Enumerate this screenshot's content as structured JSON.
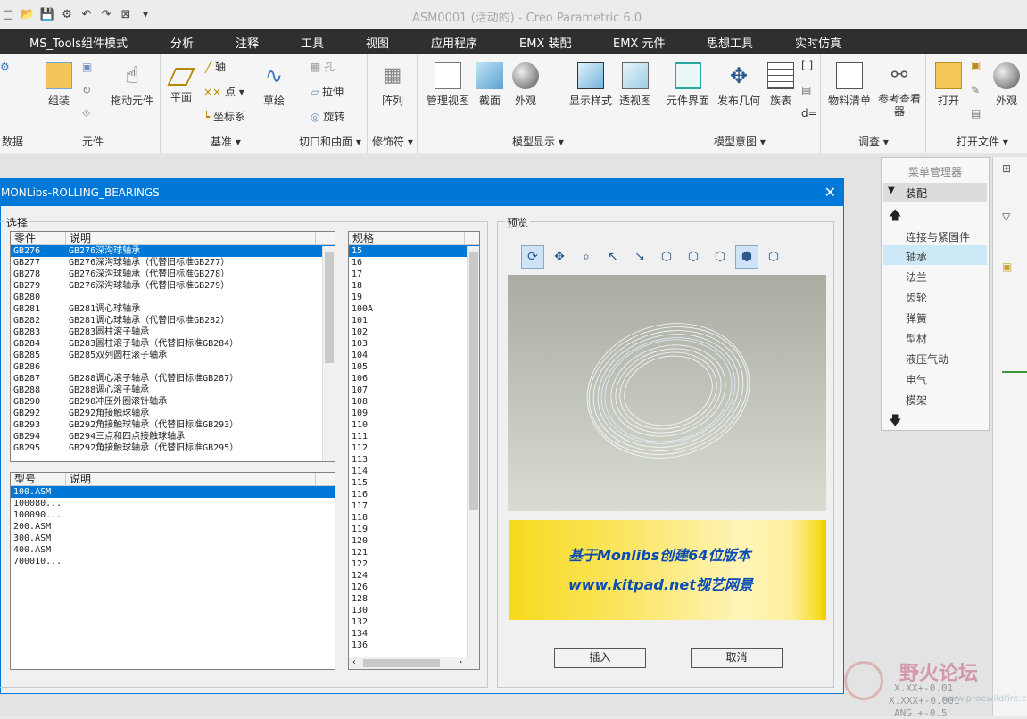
{
  "window": {
    "title": "ASM0001 (活动的) - Creo Parametric 6.0"
  },
  "menubar": [
    "MS_Tools组件模式",
    "分析",
    "注释",
    "工具",
    "视图",
    "应用程序",
    "EMX 装配",
    "EMX 元件",
    "思想工具",
    "实时仿真"
  ],
  "ribbon": {
    "groups": {
      "data": "数据",
      "component": "元件",
      "datum": "基准",
      "cut_surface": "切口和曲面",
      "modifier": "修饰符",
      "model_display": "模型显示",
      "model_intent": "模型意图",
      "investigate": "调查",
      "open_file": "打开文件"
    },
    "buttons": {
      "assemble": "组装",
      "drag": "拖动元件",
      "plane": "平面",
      "axis": "轴",
      "point": "点",
      "csys": "坐标系",
      "sketch": "草绘",
      "hole": "孔",
      "extrude": "拉伸",
      "revolve": "旋转",
      "pattern": "阵列",
      "manage_views": "管理视图",
      "section": "截面",
      "appearance": "外观",
      "display_style": "显示样式",
      "perspective": "透视图",
      "component_interface": "元件界面",
      "publish_geometry": "发布几何",
      "family_table": "族表",
      "bom": "物料清单",
      "ref_viewer": "参考查看器",
      "open": "打开",
      "appearance2": "外观"
    }
  },
  "dialog": {
    "title": "MONLibs-ROLLING_BEARINGS",
    "select_label": "选择",
    "preview_label": "预览",
    "parts_header": [
      "零件",
      "说明"
    ],
    "parts": [
      [
        "GB276",
        "GB276深沟球轴承"
      ],
      [
        "GB277",
        "GB276深沟球轴承（代替旧标准GB277）"
      ],
      [
        "GB278",
        "GB276深沟球轴承（代替旧标准GB278）"
      ],
      [
        "GB279",
        "GB276深沟球轴承（代替旧标准GB279）"
      ],
      [
        "GB280",
        ""
      ],
      [
        "GB281",
        "GB281调心球轴承"
      ],
      [
        "GB282",
        "GB281调心球轴承（代替旧标准GB282）"
      ],
      [
        "GB283",
        "GB283圆柱滚子轴承"
      ],
      [
        "GB284",
        "GB283圆柱滚子轴承（代替旧标准GB284）"
      ],
      [
        "GB285",
        "GB285双列圆柱滚子轴承"
      ],
      [
        "GB286",
        ""
      ],
      [
        "GB287",
        "GB288调心滚子轴承（代替旧标准GB287）"
      ],
      [
        "GB288",
        "GB288调心滚子轴承"
      ],
      [
        "GB290",
        "GB290冲压外圈滚针轴承"
      ],
      [
        "GB292",
        "GB292角接触球轴承"
      ],
      [
        "GB293",
        "GB292角接触球轴承（代替旧标准GB293）"
      ],
      [
        "GB294",
        "GB294三点和四点接触球轴承"
      ],
      [
        "GB295",
        "GB292角接触球轴承（代替旧标准GB295）"
      ]
    ],
    "types_header": [
      "型号",
      "说明"
    ],
    "types": [
      "100.ASM",
      "100080...",
      "100090...",
      "200.ASM",
      "300.ASM",
      "400.ASM",
      "700010..."
    ],
    "specs_header": "规格",
    "specs": [
      "15",
      "16",
      "17",
      "18",
      "19",
      "100A",
      "101",
      "102",
      "103",
      "104",
      "105",
      "106",
      "107",
      "108",
      "109",
      "110",
      "111",
      "112",
      "113",
      "114",
      "115",
      "116",
      "117",
      "118",
      "119",
      "120",
      "121",
      "122",
      "124",
      "126",
      "128",
      "130",
      "132",
      "134",
      "136"
    ],
    "banner_line1": "基于Monlibs创建64位版本",
    "banner_line2": "www.kitpad.net视艺网景",
    "insert_label": "插入",
    "cancel_label": "取消"
  },
  "menu_manager": {
    "title": "菜单管理器",
    "section": "装配",
    "items": [
      "连接与紧固件",
      "轴承",
      "法兰",
      "齿轮",
      "弹簧",
      "型材",
      "液压气动",
      "电气",
      "模架"
    ],
    "selected": "轴承"
  },
  "watermark": {
    "brand": "野火论坛",
    "line1": "X.XX+-0.01",
    "line2": "X.XXX+-0.001",
    "line3": "ANG.+-0.5",
    "url": "www.proewildfire.cn"
  },
  "colors": {
    "accent": "#0078d7",
    "menubar": "#2f2f2f"
  }
}
